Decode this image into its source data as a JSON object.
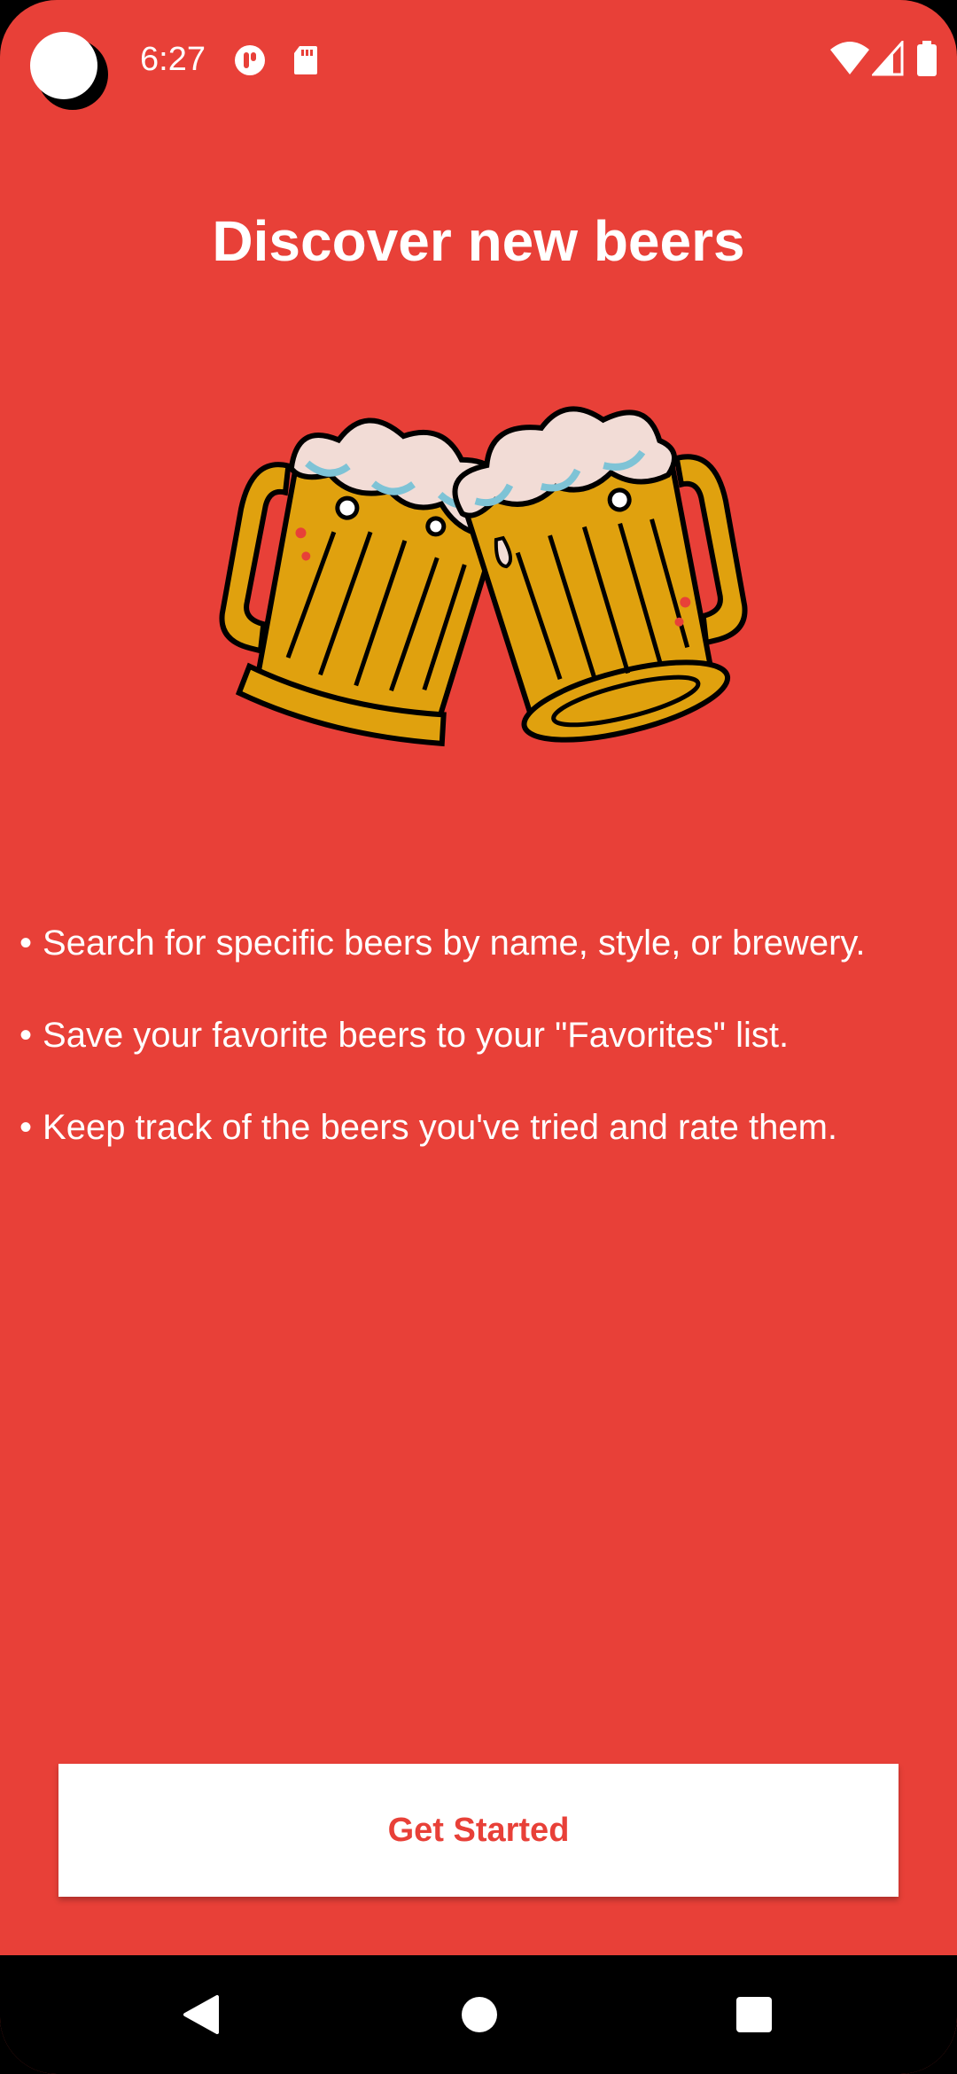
{
  "status_bar": {
    "time": "6:27",
    "icons": [
      "camera-cutout",
      "app-notification-icon",
      "sd-card-icon",
      "wifi-icon",
      "cellular-signal-icon",
      "battery-icon"
    ]
  },
  "onboarding": {
    "title": "Discover new beers",
    "illustration": "beer-mugs-cheers",
    "features": [
      "Search for specific beers by name, style, or brewery.",
      "Save your favorite beers to your \"Favorites\" list.",
      "Keep track of the beers you've tried and rate them."
    ],
    "bullet": "•",
    "cta_label": "Get Started"
  },
  "nav_bar": {
    "buttons": [
      "back-icon",
      "home-icon",
      "recents-icon"
    ]
  },
  "colors": {
    "background": "#E84038",
    "button_bg": "#FFFFFF",
    "button_text": "#E84038",
    "beer": "#E0A10E",
    "foam": "#F2DCD6",
    "foam_shadow": "#7EC3D6"
  }
}
